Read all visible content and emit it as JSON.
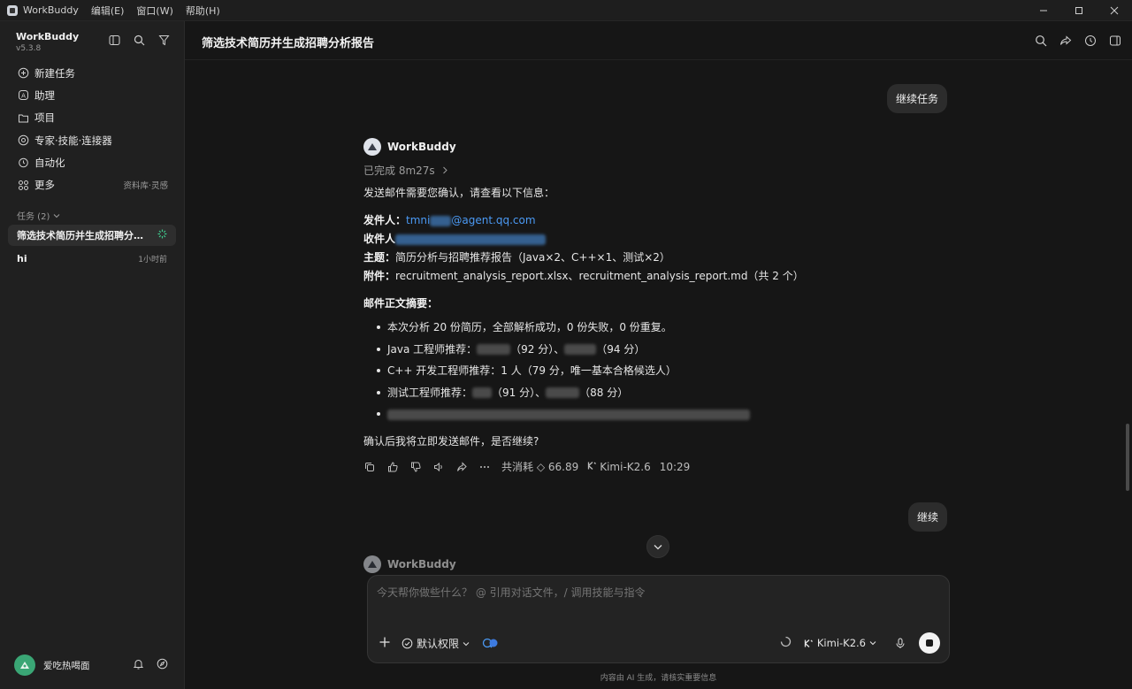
{
  "titlebar": {
    "app_name": "WorkBuddy",
    "menus": [
      "编辑(E)",
      "窗口(W)",
      "帮助(H)"
    ]
  },
  "sidebar": {
    "brand": "WorkBuddy",
    "version": "v5.3.8",
    "nav": [
      {
        "label": "新建任务",
        "icon": "plus-circle-icon",
        "extra": ""
      },
      {
        "label": "助理",
        "icon": "assistant-icon",
        "extra": ""
      },
      {
        "label": "项目",
        "icon": "folder-icon",
        "extra": ""
      },
      {
        "label": "专家·技能·连接器",
        "icon": "expert-icon",
        "extra": ""
      },
      {
        "label": "自动化",
        "icon": "alarm-icon",
        "extra": ""
      },
      {
        "label": "更多",
        "icon": "grid-icon",
        "extra": "资料库·灵感"
      }
    ],
    "tasks_header": "任务 (2)",
    "tasks": [
      {
        "label": "筛选技术简历并生成招聘分…",
        "meta": "",
        "active": true
      },
      {
        "label": "hi",
        "meta": "1小时前",
        "active": false
      }
    ],
    "user_name": "爱吃热喝面"
  },
  "main": {
    "title": "筛选技术简历并生成招聘分析报告",
    "user_msg_1": "继续任务",
    "agent_name": "WorkBuddy",
    "done_label": "已完成 8m27s",
    "intro": "发送邮件需要您确认，请查看以下信息：",
    "sender_label": "发件人：",
    "sender_value_prefix": "tmni",
    "sender_value_suffix": "@agent.qq.com",
    "recipient_label": "收件人",
    "subject_label": "主题：",
    "subject_value": "简历分析与招聘推荐报告（Java×2、C++×1、测试×2）",
    "attach_label": "附件：",
    "attach_value": "recruitment_analysis_report.xlsx、recruitment_analysis_report.md（共 2 个）",
    "summary_title": "邮件正文摘要：",
    "summary": {
      "l1": "本次分析 20 份简历，全部解析成功，0 份失败，0 份重复。",
      "l2_a": "Java 工程师推荐：",
      "l2_b": "（92 分）、",
      "l2_c": "（94 分）",
      "l3": "C++ 开发工程师推荐：1 人（79 分，唯一基本合格候选人）",
      "l4_a": "测试工程师推荐：",
      "l4_b": "（91 分）、",
      "l4_c": "（88 分）"
    },
    "confirm": "确认后我将立即发送邮件，是否继续?",
    "cost": "共消耗 ◇ 66.89",
    "model": "Kimi-K2.6",
    "time": "10:29",
    "user_msg_2": "继续",
    "peek_name": "WorkBuddy"
  },
  "composer": {
    "placeholder": "今天帮你做些什么？ @ 引用对话文件，/ 调用技能与指令",
    "permission": "默认权限",
    "model": "Kimi-K2.6"
  },
  "disclaimer": "内容由 AI 生成，请核实重要信息"
}
